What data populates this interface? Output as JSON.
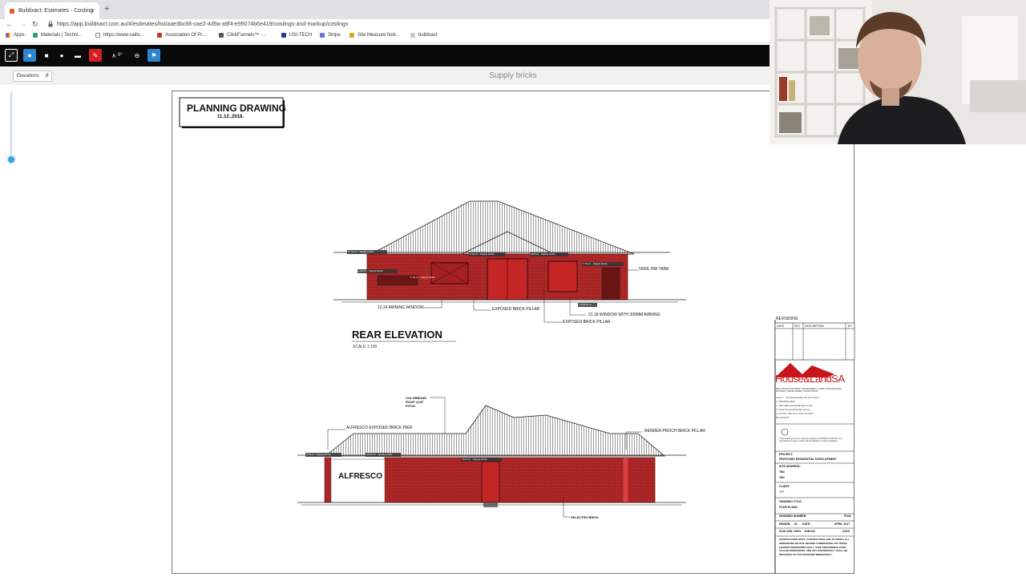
{
  "browser": {
    "tab_title": "Buildxact: Estimates - Costing",
    "tab_close": "×",
    "new_tab": "+",
    "url": "https://app.buildxact.com.au/#/estimates/list/aae3bc86-cae2-4d9a-a9f4-e95074b6e419/costings-and-markup/costings",
    "bookmarks": [
      "Apps",
      "Materials | Techni...",
      "https://www.sailis...",
      "Association Of Pr...",
      "ClickFunnels™ - ...",
      "USI-TECH",
      "Stripe",
      "Site Measure Noti...",
      "buildxact"
    ]
  },
  "toolbar": {
    "zoom_label": "0°"
  },
  "subbar": {
    "view_select": "Elevations",
    "page_title": "Supply bricks"
  },
  "drawing": {
    "title_block": {
      "title": "PLANNING DRAWING",
      "date": "11.12..2018."
    },
    "rear": {
      "heading": "REAR ELEVATION",
      "scale": "SCALE 1:100",
      "labels": {
        "tank": "5000L RW TANK",
        "awning_window": "12.24 AWNING WINDOW",
        "brick_pillar": "EXPOSED BRICK PILLAR",
        "window_3000": "21.18 WINDOW WITH 300MM AWNING",
        "brick_pillar_2": "EXPOSED BRICK PILLAR"
      },
      "markups": [
        "27.13 m² · Supply bricks",
        "9.16 m² · Supply bricks",
        "5.08 m² · Supply bricks",
        "1.76 m² · Supply bricks",
        "1.63 m² · Supply bricks",
        "1.16 m² · Supply bricks",
        "1.34/4.57 m"
      ]
    },
    "side": {
      "roof_label": "COLORBOND ROOF @25° PITCH",
      "labels": {
        "alfresco_pier": "ALFRESCO EXPOSED BRICK PIER",
        "porch_pillar": "RENDER PROCH BRICK PILLAR",
        "selected_brick": "SELECTED BRICK",
        "alfresco": "ALFRESCO"
      },
      "markups": [
        "0.75 m² · Supply bricks",
        "22.54 m² · Supply bricks",
        "5.21 m² · Supply bricks"
      ]
    },
    "titleblock": {
      "revisions": "REVISIONS",
      "cols": [
        "DATE",
        "REV",
        "DESCRIPTION",
        "BY"
      ],
      "company": "House&LandSA",
      "company_tag": "REAL ESTATE | PROPERTY MANAGEMENT | HOME LOANS BUILDING ADVISORY | DEVELOPMENT CONSULTANTS",
      "address": [
        "Level 1 - 10 Dequetteville Tce Kent Town",
        "p: (08) 8362 0022",
        "e: admin@houseandlandsa.net.au",
        "w: www.houseandlandsa.net.au",
        "a: P.O Box 344 Kent Town SA 5071",
        "RLA 204776"
      ],
      "notice": "These drawings are the exclusive property of HOUSE & LAND SA. Any reproduction in part or whole without authority is strictly prohibited.",
      "project_label": "PROJECT:",
      "project": "PROPOSED RESIDENTIAL DEVELOPMENT",
      "site_label": "SITE ADDRESS:",
      "site": [
        "TBC",
        "TBC"
      ],
      "client_label": "CLIENT:",
      "client": "???",
      "drawing_title_label": "DRAWING TITLE:",
      "drawing_title": "FOUR PLANS",
      "drawing_number_label": "DRAWING NUMBER:",
      "drawing_number": "PD03",
      "drawn_label": "DRAWN:",
      "drawn": "DI",
      "date_label": "DATE:",
      "date": "APRIL 2017",
      "scale_label": "SCA/ DI/D:",
      "scale": "1/H01",
      "job_label": "JOB NO:",
      "job": "XXXX",
      "contractors_note": "CONTRACTORS NOTE: CONTRACTORS ARE TO VERIFY ALL DIMENSIONS ON-SITE BEFORE COMMENCING ANY WORK. FIGURED DIMENSIONS SHALL TAKE PREFERENCE OVER SCALED DIMENSIONS, AND ANY DISCREPANCY SHALL BE REPORTED TO THE DESIGNER IMMEDIATELY."
    }
  },
  "colors": {
    "brick_fill": "#b52a2a",
    "markup_red": "#cc1f1f",
    "toolbar_blue": "#2e86cf",
    "logo_red": "#c8141b"
  }
}
